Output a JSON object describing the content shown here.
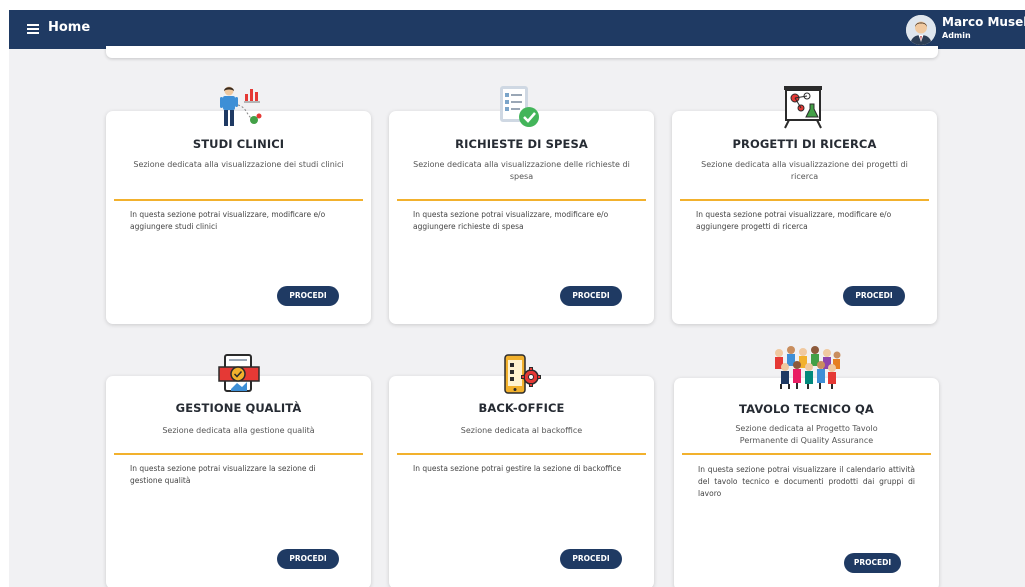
{
  "header": {
    "title": "Home",
    "user_name": "Marco Musella",
    "user_role": "Admin"
  },
  "colors": {
    "primary": "#1f3a63",
    "accent": "#f2b12d",
    "background": "#f1f1f3"
  },
  "cards": [
    {
      "title": "STUDI CLINICI",
      "subtitle": "Sezione dedicata alla visualizzazione dei studi clinici",
      "body": "In questa sezione potrai visualizzare, modificare e/o aggiungere studi clinici",
      "button": "PROCEDI",
      "icon": "clinical-study-icon"
    },
    {
      "title": "RICHIESTE DI SPESA",
      "subtitle": "Sezione dedicata alla visualizzazione delle richieste di spesa",
      "body": "In questa sezione potrai visualizzare, modificare e/o aggiungere richieste di spesa",
      "button": "PROCEDI",
      "icon": "checklist-icon"
    },
    {
      "title": "PROGETTI DI RICERCA",
      "subtitle": "Sezione dedicata alla visualizzazione dei progetti di ricerca",
      "body": "In questa sezione potrai visualizzare, modificare e/o aggiungere progetti di ricerca",
      "button": "PROCEDI",
      "icon": "research-board-icon"
    },
    {
      "title": "GESTIONE QUALITÀ",
      "subtitle": "Sezione dedicata alla gestione qualità",
      "body": "In questa sezione potrai visualizzare la sezione di gestione qualità",
      "button": "PROCEDI",
      "icon": "quality-certificate-icon"
    },
    {
      "title": "BACK-OFFICE",
      "subtitle": "Sezione dedicata al backoffice",
      "body": "In questa sezione potrai gestire la sezione di backoffice",
      "button": "PROCEDI",
      "icon": "phone-settings-icon"
    },
    {
      "title": "TAVOLO TECNICO QA",
      "subtitle": "Sezione dedicata al Progetto Tavolo Permanente di Quality Assurance",
      "body": "In questa sezione potrai visualizzare il calendario attività del tavolo tecnico e documenti prodotti dai gruppi di lavoro",
      "button": "PROCEDI",
      "icon": "team-group-icon"
    }
  ]
}
